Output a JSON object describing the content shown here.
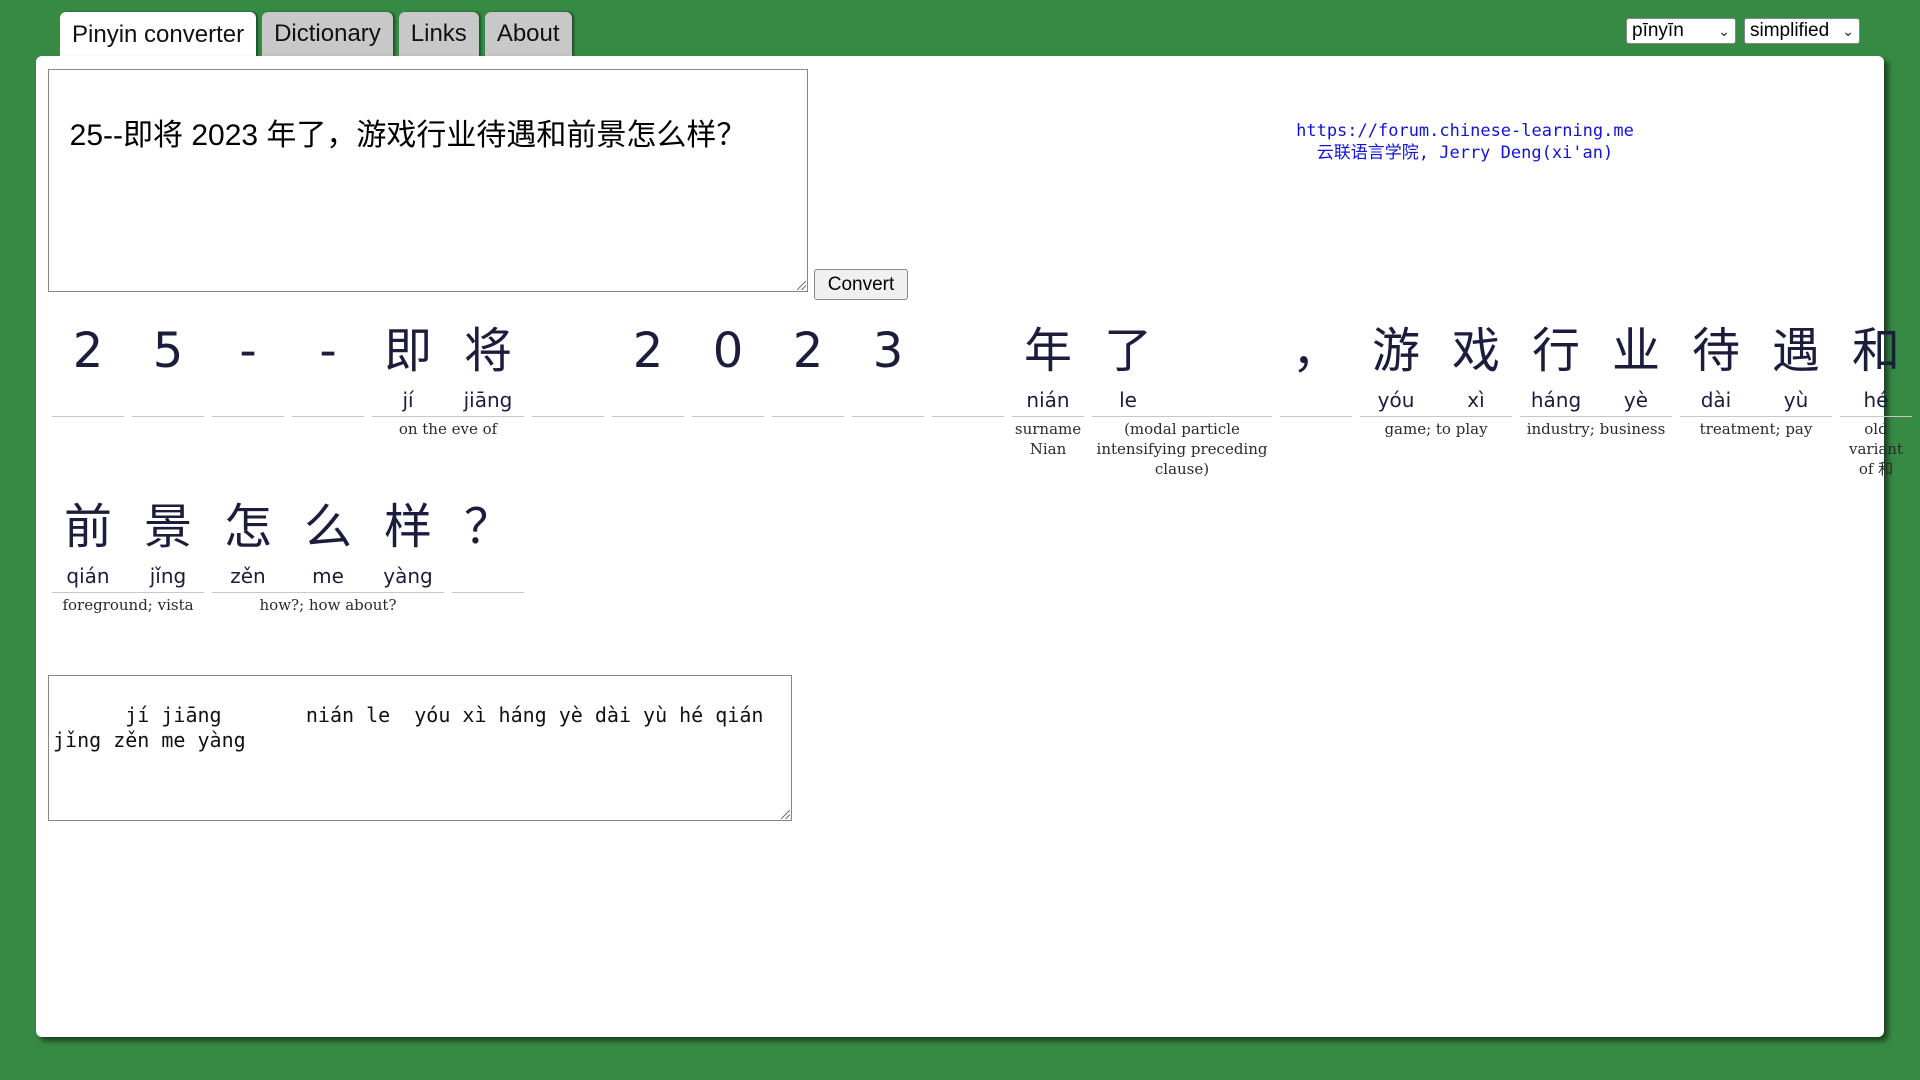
{
  "tabs": [
    {
      "label": "Pinyin converter",
      "active": true
    },
    {
      "label": "Dictionary",
      "active": false
    },
    {
      "label": "Links",
      "active": false
    },
    {
      "label": "About",
      "active": false
    }
  ],
  "selects": {
    "romanization": "pīnyīn",
    "script": "simplified"
  },
  "input_text": "25--即将 2023 年了，游戏行业待遇和前景怎么样？",
  "convert_label": "Convert",
  "credits": {
    "line1": "https://forum.chinese-learning.me",
    "line2": "云联语言学院, Jerry Deng(xi'an)"
  },
  "rows": [
    [
      {
        "chars": [
          {
            "hz": "2",
            "py": ""
          }
        ],
        "gloss": ""
      },
      {
        "chars": [
          {
            "hz": "5",
            "py": ""
          }
        ],
        "gloss": ""
      },
      {
        "chars": [
          {
            "hz": "-",
            "py": ""
          }
        ],
        "gloss": ""
      },
      {
        "chars": [
          {
            "hz": "-",
            "py": ""
          }
        ],
        "gloss": ""
      },
      {
        "chars": [
          {
            "hz": "即",
            "py": "jí"
          },
          {
            "hz": "将",
            "py": "jiāng"
          }
        ],
        "gloss": "on the eve of"
      },
      {
        "chars": [
          {
            "hz": "",
            "py": ""
          }
        ],
        "gloss": ""
      },
      {
        "chars": [
          {
            "hz": "2",
            "py": ""
          }
        ],
        "gloss": ""
      },
      {
        "chars": [
          {
            "hz": "0",
            "py": ""
          }
        ],
        "gloss": ""
      },
      {
        "chars": [
          {
            "hz": "2",
            "py": ""
          }
        ],
        "gloss": ""
      },
      {
        "chars": [
          {
            "hz": "3",
            "py": ""
          }
        ],
        "gloss": ""
      },
      {
        "chars": [
          {
            "hz": "",
            "py": ""
          }
        ],
        "gloss": ""
      },
      {
        "chars": [
          {
            "hz": "年",
            "py": "nián"
          }
        ],
        "gloss": "surname Nian"
      },
      {
        "chars": [
          {
            "hz": "了",
            "py": "le"
          }
        ],
        "gloss": "(modal particle intensifying preceding clause)"
      },
      {
        "chars": [
          {
            "hz": "，",
            "py": ""
          }
        ],
        "gloss": ""
      },
      {
        "chars": [
          {
            "hz": "游",
            "py": "yóu"
          },
          {
            "hz": "戏",
            "py": "xì"
          }
        ],
        "gloss": "game; to play"
      },
      {
        "chars": [
          {
            "hz": "行",
            "py": "háng"
          },
          {
            "hz": "业",
            "py": "yè"
          }
        ],
        "gloss": "industry; business"
      },
      {
        "chars": [
          {
            "hz": "待",
            "py": "dài"
          },
          {
            "hz": "遇",
            "py": "yù"
          }
        ],
        "gloss": "treatment; pay"
      },
      {
        "chars": [
          {
            "hz": "和",
            "py": "hé"
          }
        ],
        "gloss": "old variant of 和"
      }
    ],
    [
      {
        "chars": [
          {
            "hz": "前",
            "py": "qián"
          },
          {
            "hz": "景",
            "py": "jǐng"
          }
        ],
        "gloss": "foreground; vista"
      },
      {
        "chars": [
          {
            "hz": "怎",
            "py": "zěn"
          },
          {
            "hz": "么",
            "py": "me"
          },
          {
            "hz": "样",
            "py": "yàng"
          }
        ],
        "gloss": "how?; how about?"
      },
      {
        "chars": [
          {
            "hz": "？",
            "py": ""
          }
        ],
        "gloss": ""
      }
    ]
  ],
  "output_text": "    jí jiāng       nián le  yóu xì háng yè dài yù hé qián\njǐng zěn me yàng"
}
